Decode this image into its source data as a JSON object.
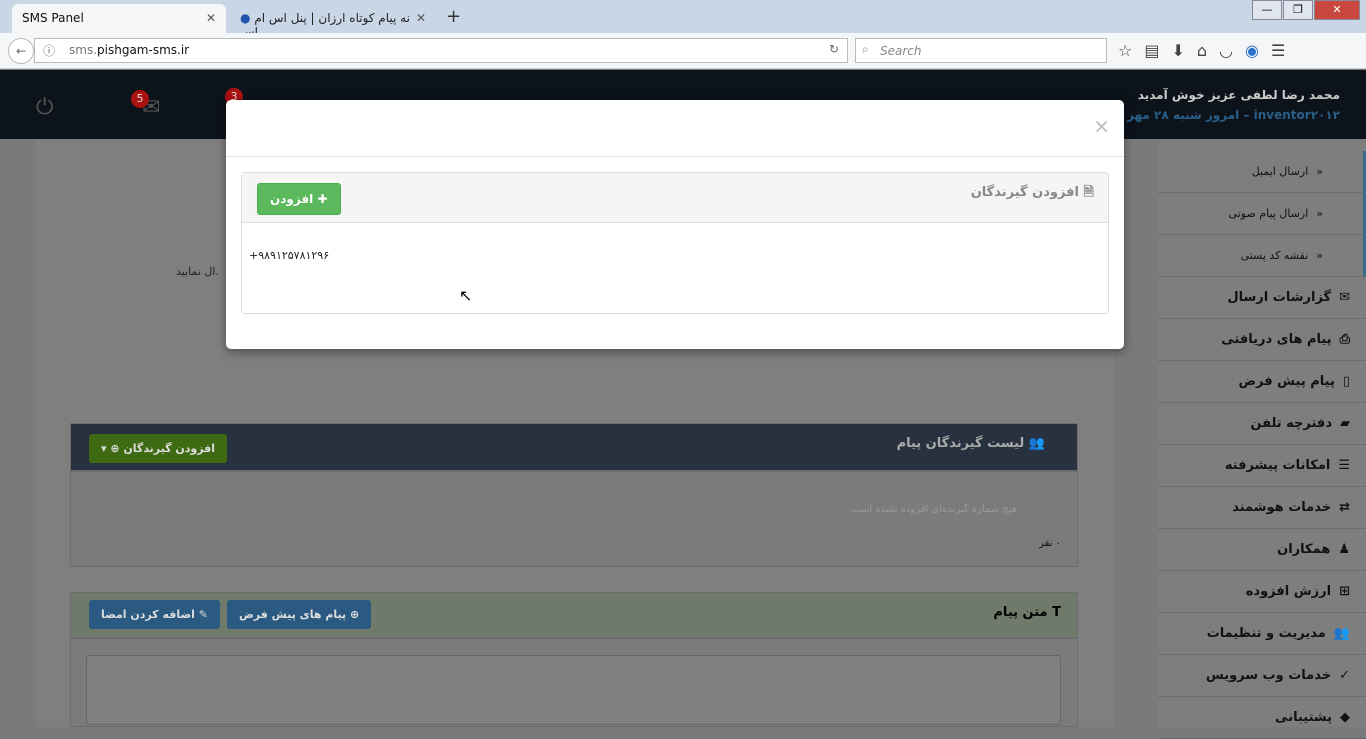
{
  "browser": {
    "tabs": [
      {
        "label": "SMS Panel"
      },
      {
        "label": "نه پیام کوتاه ارزان | پنل اس ام اس"
      }
    ],
    "new_tab": "+",
    "url_prefix": "sms.",
    "url_domain": "pishgam-sms.ir",
    "search_placeholder": "Search"
  },
  "header": {
    "welcome": "محمد رضا لطفی عزیز خوش آمدید",
    "date": "inventor۲۰۱۲ – امروز شنبه ۲۸ مهر",
    "mail_badge": "5",
    "notif_badge": "3"
  },
  "sidebar": {
    "items": [
      {
        "label": "ارسال ایمیل",
        "sub": true
      },
      {
        "label": "ارسال پیام صوتی",
        "sub": true
      },
      {
        "label": "نقشه کد پستی",
        "sub": true
      },
      {
        "label": "گزارشات ارسال",
        "icon": "envelope-icon"
      },
      {
        "label": "پیام های دریافتی",
        "icon": "inbox-icon"
      },
      {
        "label": "پیام پیش فرض",
        "icon": "tablet-icon"
      },
      {
        "label": "دفترچه تلفن",
        "icon": "book-icon"
      },
      {
        "label": "امکانات پیشرفته",
        "icon": "list-icon"
      },
      {
        "label": "خدمات هوشمند",
        "icon": "retweet-icon"
      },
      {
        "label": "همکاران",
        "icon": "user-icon"
      },
      {
        "label": "ارزش افزوده",
        "icon": "plus-square-icon"
      },
      {
        "label": "مدیریت و تنظیمات",
        "icon": "users-icon"
      },
      {
        "label": "خدمات وب سرویس",
        "icon": "check-circle-icon"
      },
      {
        "label": "پشتیبانی",
        "icon": "tag-icon"
      }
    ]
  },
  "main": {
    "partial_text": "ال نمایید.",
    "recipients_title": "لیست گیرندگان پیام",
    "add_recipients_btn": "افزودن گیرندگان",
    "empty_text": "هیچ شماره گیرنده‌ای افزوده نشده است",
    "count": "۰ نفر",
    "message_title": "متن پیام",
    "default_msgs_btn": "پیام های پیش فرض",
    "add_signature_btn": "اضافه کردن امضا"
  },
  "modal": {
    "title": "افزودن گیرندگان",
    "add_btn": "افزودن",
    "phone": "+۹۸۹۱۲۵۷۸۱۲۹۶",
    "close": "×"
  },
  "colors": {
    "success": "#5cb85c",
    "primary": "#337ab7",
    "header": "#0d131a"
  }
}
